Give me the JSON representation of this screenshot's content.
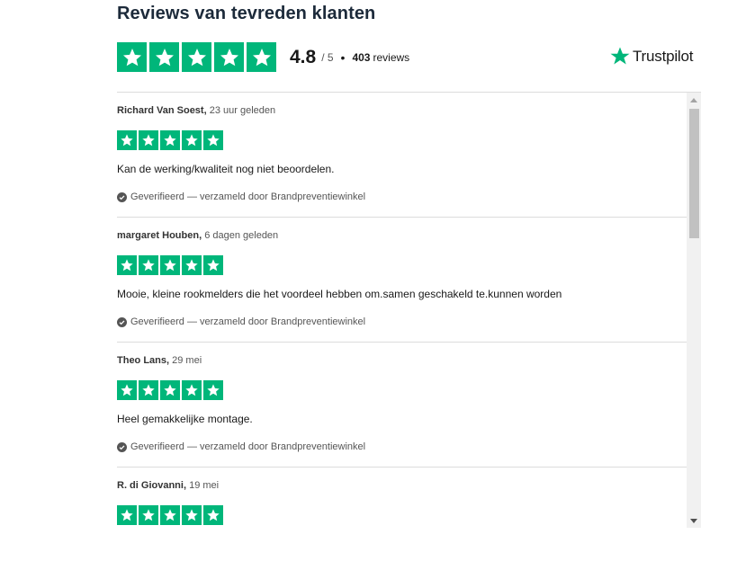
{
  "header": {
    "title": "Reviews van tevreden klanten"
  },
  "summary": {
    "score": "4.8",
    "out_of": "/ 5",
    "separator": "•",
    "review_count": "403",
    "review_count_label": "reviews",
    "star_count": 5,
    "brand": "Trustpilot"
  },
  "colors": {
    "star_green": "#00b67a",
    "heading": "#1c2a3a"
  },
  "reviews": [
    {
      "author": "Richard Van Soest,",
      "date": "23 uur geleden",
      "text": "Kan de werking/kwaliteit nog niet beoordelen.",
      "verified": "Geverifieerd — verzameld door Brandpreventiewinkel",
      "rating": 5
    },
    {
      "author": "margaret Houben,",
      "date": "6 dagen geleden",
      "text": "Mooie, kleine rookmelders die het voordeel hebben om.samen geschakeld te.kunnen worden",
      "verified": "Geverifieerd — verzameld door Brandpreventiewinkel",
      "rating": 5
    },
    {
      "author": "Theo Lans,",
      "date": "29 mei",
      "text": "Heel gemakkelijke montage.",
      "verified": "Geverifieerd — verzameld door Brandpreventiewinkel",
      "rating": 5
    },
    {
      "author": "R. di Giovanni,",
      "date": "19 mei",
      "text": "",
      "verified": "",
      "rating": 5
    }
  ],
  "icons": {
    "star": "star-icon",
    "verified": "check-circle-icon",
    "brand": "trustpilot-star-icon",
    "scroll_up": "triangle-up-icon",
    "scroll_down": "triangle-down-icon"
  }
}
